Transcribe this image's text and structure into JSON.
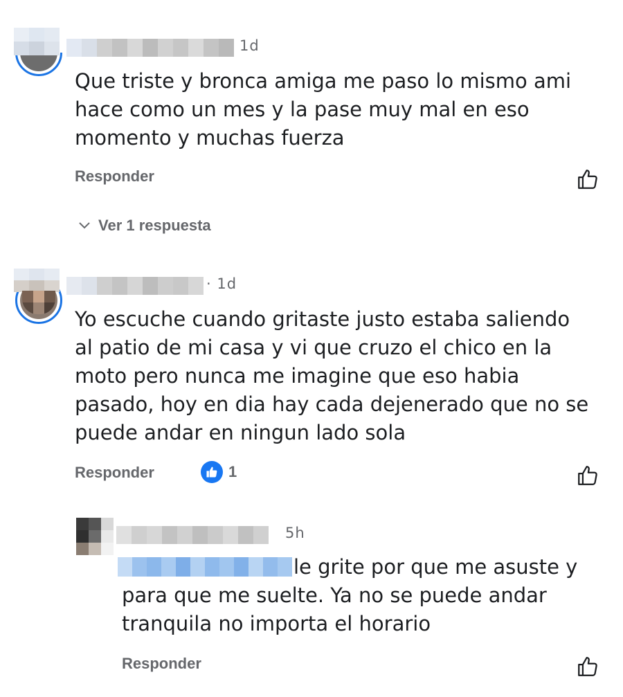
{
  "comments": [
    {
      "time": "1d",
      "text_lines": [
        "Que triste y bronca amiga me paso lo mismo ami",
        "hace como un mes y la pase muy mal en eso",
        "momento y muchas fuerza"
      ],
      "reply_label": "Responder",
      "view_replies_label": "Ver 1 respuesta"
    },
    {
      "time": "· 1d",
      "text_lines": [
        "Yo escuche cuando gritaste justo estaba saliendo",
        "al patio de mi casa y vi que cruzo el chico en la",
        "moto pero nunca me imagine que eso habia",
        "pasado, hoy en dia hay cada dejenerado que no se",
        "puede andar en ningun lado sola"
      ],
      "reply_label": "Responder",
      "reaction_count": "1"
    }
  ],
  "reply": {
    "time": "5h",
    "text_lines": [
      "le grite por que me asuste y",
      "para que me suelte. Ya no se puede andar",
      "tranquila no importa el horario"
    ],
    "reply_label": "Responder"
  },
  "colors": {
    "accent": "#1b74e4",
    "secondary_text": "#65676b",
    "primary_text": "#1c1e21"
  },
  "icons": {
    "like": "thumbs-up-outline-icon",
    "reaction": "thumbs-up-filled-icon",
    "chevron": "chevron-down-icon"
  }
}
